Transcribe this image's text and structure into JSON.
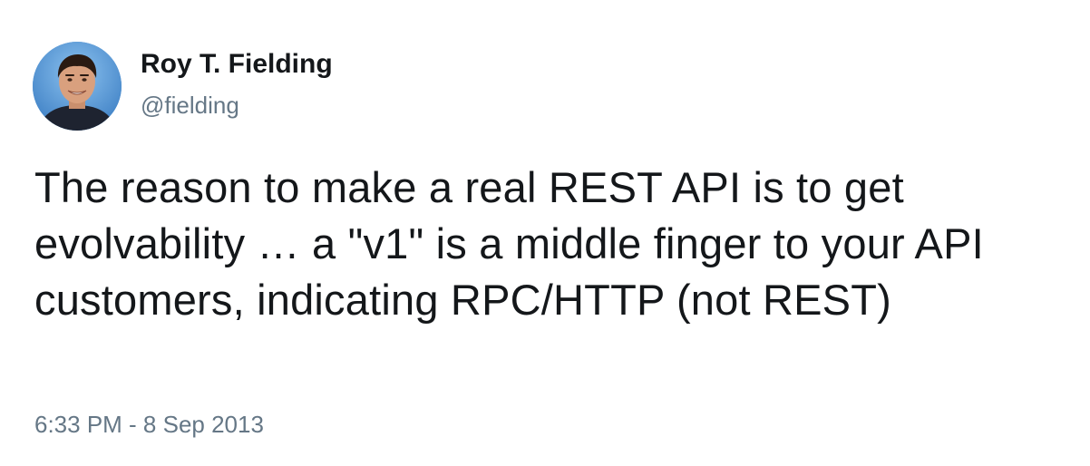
{
  "tweet": {
    "author": {
      "name": "Roy T. Fielding",
      "handle": "@fielding"
    },
    "text": "The reason to make a real REST API is to get evolvability … a \"v1\" is a middle finger to your API customers, indicating RPC/HTTP (not REST)",
    "timestamp": "6:33 PM - 8 Sep 2013"
  },
  "colors": {
    "text_primary": "#14171a",
    "text_secondary": "#657786",
    "avatar_background": "#5a9bd8"
  }
}
